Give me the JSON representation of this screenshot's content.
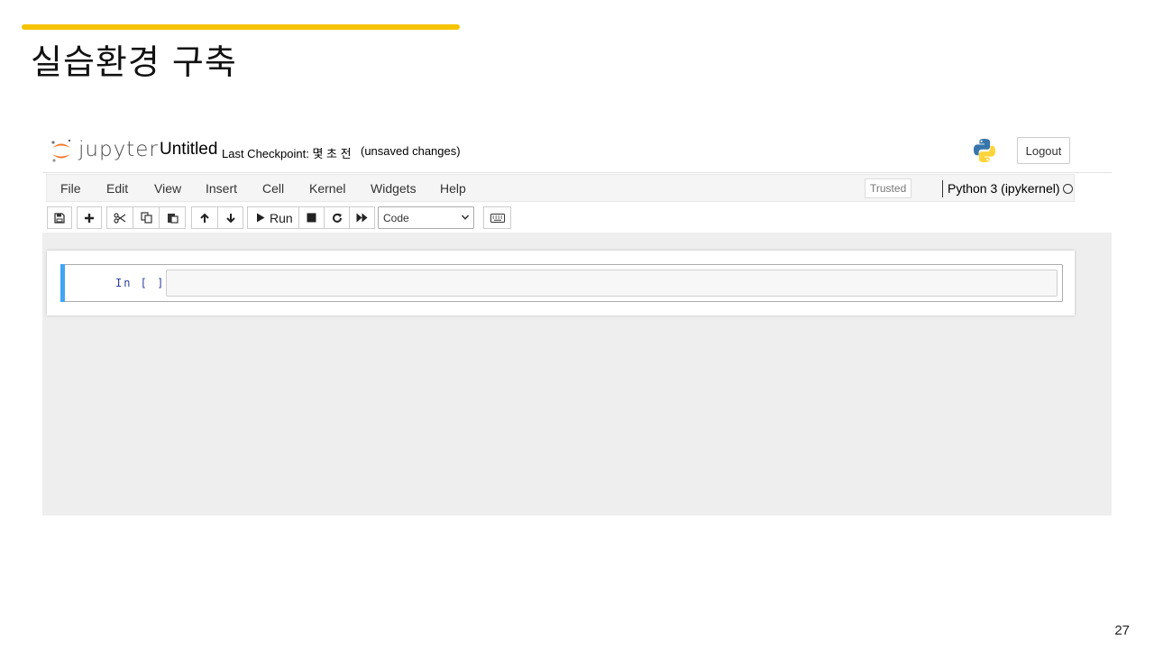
{
  "slide": {
    "title": "실습환경 구축",
    "page_number": "27",
    "accent_color": "#f5c300"
  },
  "jupyter": {
    "wordmark": "jupyter",
    "notebook_title": "Untitled",
    "checkpoint": "Last Checkpoint: 몇 초 전",
    "unsaved": "(unsaved changes)",
    "logout_label": "Logout",
    "menu": [
      "File",
      "Edit",
      "View",
      "Insert",
      "Cell",
      "Kernel",
      "Widgets",
      "Help"
    ],
    "trusted_label": "Trusted",
    "kernel_name": "Python 3 (ipykernel)",
    "toolbar": {
      "run_label": "Run",
      "cell_type": "Code",
      "icons": [
        "save-icon",
        "plus-icon",
        "cut-icon",
        "copy-icon",
        "paste-icon",
        "arrow-up-icon",
        "arrow-down-icon",
        "play-icon",
        "stop-icon",
        "restart-icon",
        "fast-forward-icon",
        "keyboard-icon"
      ]
    },
    "cell": {
      "prompt": "In [ ]:",
      "content": "",
      "selected_bar_color": "#42a5f5"
    },
    "logo_colors": {
      "orange": "#f37726",
      "python_blue": "#3776ab",
      "python_yellow": "#ffd43b"
    }
  }
}
